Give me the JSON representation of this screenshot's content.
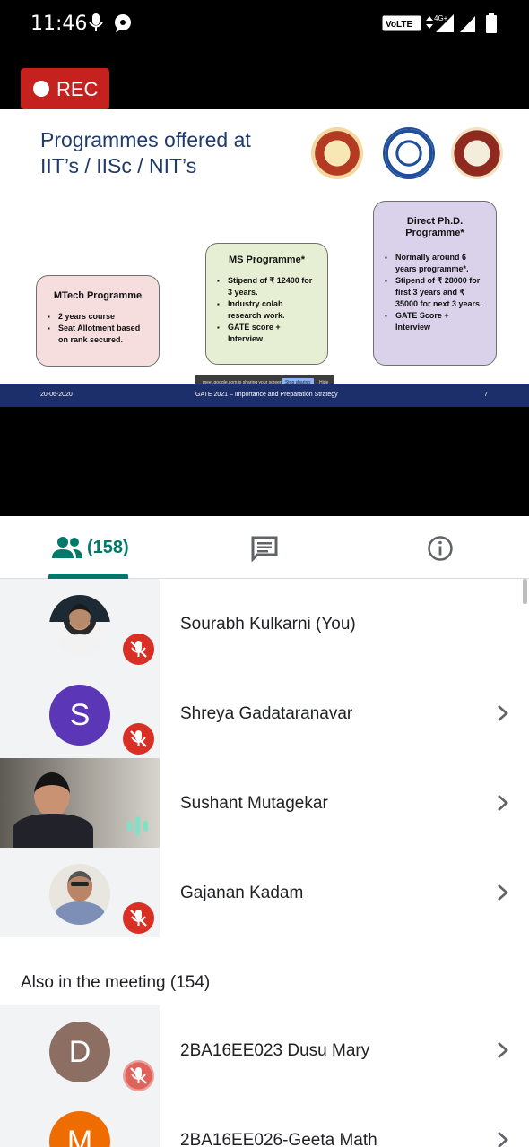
{
  "status_bar": {
    "time": "11:46",
    "network": "VoLTE",
    "data": "4G+"
  },
  "recording": {
    "label": "REC"
  },
  "slide": {
    "title_line1": "Programmes offered at",
    "title_line2": "IIT’s / IISc / NIT’s",
    "mtech": {
      "heading": "MTech Programme",
      "bullets": [
        "2 years course",
        "Seat Allotment based on rank secured."
      ]
    },
    "ms": {
      "heading": "MS Programme*",
      "bullets": [
        "Stipend of ₹ 12400 for 3 years.",
        "Industry colab research work.",
        "GATE score + Interview"
      ]
    },
    "phd": {
      "heading": "Direct Ph.D. Programme*",
      "bullets": [
        "Normally around 6 years programme*.",
        "Stipend of ₹ 28000 for first 3 years and ₹ 35000 for next 3 years.",
        "GATE Score + Interview"
      ]
    },
    "footer_date": "20-06-2020",
    "footer_title": "GATE 2021 – Importance and Preparation Strategy",
    "footer_page": "7",
    "share_notice": "meet.google.com is sharing your screen.",
    "stop_sharing": "Stop sharing",
    "hide": "Hide"
  },
  "tabs": {
    "people_count": "(158)"
  },
  "participants": [
    {
      "name": "Sourabh Kulkarni (You)",
      "muted": true,
      "avatar": "photo"
    },
    {
      "name": "Shreya Gadataranavar",
      "muted": true,
      "avatar_letter": "S",
      "avatar_color": "#5b37b8"
    },
    {
      "name": "Sushant Mutagekar",
      "muted": false,
      "speaking": true,
      "avatar": "video"
    },
    {
      "name": "Gajanan Kadam",
      "muted": true,
      "avatar": "photo"
    }
  ],
  "also_in_meeting": {
    "title": "Also in the meeting (154)",
    "items": [
      {
        "name": "2BA16EE023 Dusu Mary",
        "avatar_letter": "D",
        "avatar_color": "#8d6e63"
      },
      {
        "name": "2BA16EE026-Geeta Math",
        "avatar_letter": "M",
        "avatar_color": "#ef6c00"
      }
    ]
  },
  "colors": {
    "accent": "#00796b",
    "mute_red": "#d93025",
    "rec_red": "#c5221f",
    "slide_footer": "#1d2f6b"
  }
}
